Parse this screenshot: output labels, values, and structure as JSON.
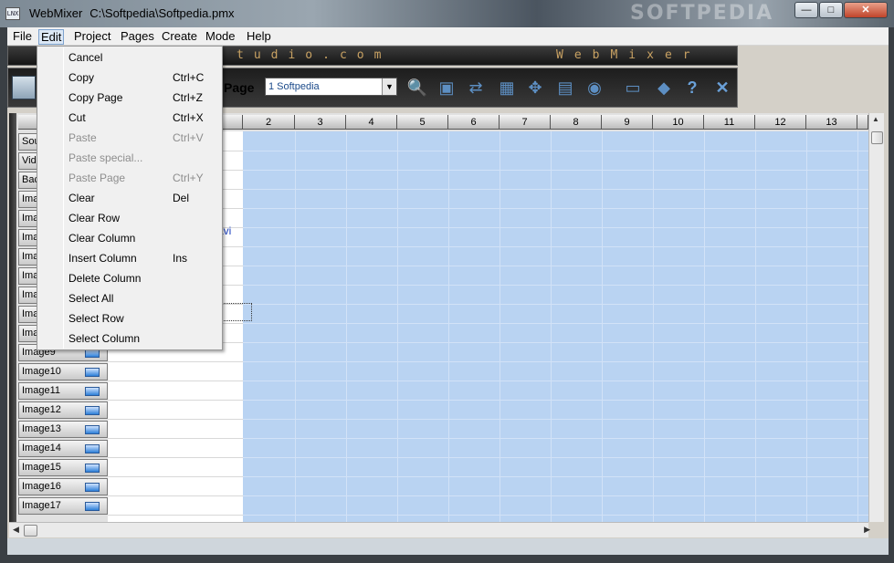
{
  "window": {
    "app_name": "WebMixer",
    "file_path": "C:\\Softpedia\\Softpedia.pmx",
    "app_icon_text": "LNX",
    "watermark": "SOFTPEDIA",
    "controls": {
      "minimize": "—",
      "maximize": "□",
      "close": "✕"
    }
  },
  "menubar": {
    "items": [
      "File",
      "Edit",
      "Project",
      "Pages",
      "Create",
      "Mode",
      "Help"
    ],
    "active": "Edit"
  },
  "banner": {
    "left_text": "tudio.com",
    "right_text": "WebMixer"
  },
  "toolbar": {
    "page_label": "Page",
    "page_select_value": "1  Softpedia",
    "icons": [
      "preview-icon",
      "save-icon",
      "swap-icon",
      "grid-icon",
      "move-icon",
      "table-icon",
      "publish-icon",
      "dialog-icon",
      "book-icon",
      "help-icon",
      "exit-icon"
    ]
  },
  "edit_menu": {
    "items": [
      {
        "label": "Cancel",
        "shortcut": "",
        "enabled": true
      },
      {
        "label": "Copy",
        "shortcut": "Ctrl+C",
        "enabled": true
      },
      {
        "label": "Copy Page",
        "shortcut": "Ctrl+Z",
        "enabled": true
      },
      {
        "label": "Cut",
        "shortcut": "Ctrl+X",
        "enabled": true
      },
      {
        "label": "Paste",
        "shortcut": "Ctrl+V",
        "enabled": false
      },
      {
        "label": "Paste special...",
        "shortcut": "",
        "enabled": false
      },
      {
        "label": "Paste Page",
        "shortcut": "Ctrl+Y",
        "enabled": false
      },
      {
        "label": "Clear",
        "shortcut": "Del",
        "enabled": true
      },
      {
        "label": "Clear Row",
        "shortcut": "",
        "enabled": true
      },
      {
        "label": "Clear Column",
        "shortcut": "",
        "enabled": true
      },
      {
        "label": "Insert Column",
        "shortcut": "Ins",
        "enabled": true
      },
      {
        "label": "Delete Column",
        "shortcut": "",
        "enabled": true
      },
      {
        "label": "Select All",
        "shortcut": "",
        "enabled": true
      },
      {
        "label": "Select Row",
        "shortcut": "",
        "enabled": true
      },
      {
        "label": "Select Column",
        "shortcut": "",
        "enabled": true
      }
    ]
  },
  "grid": {
    "column_headers": [
      "2",
      "3",
      "4",
      "5",
      "6",
      "7",
      "8",
      "9",
      "10",
      "11",
      "12",
      "13"
    ],
    "row_headers": [
      "Sou",
      "Vide",
      "Bac",
      "Imag",
      "Imag",
      "Imag",
      "Imag",
      "Imag",
      "Imag",
      "Imag",
      "Imag",
      "Image9",
      "Image10",
      "Image11",
      "Image12",
      "Image13",
      "Image14",
      "Image15",
      "Image16",
      "Image17"
    ],
    "cell_text": "avi"
  }
}
